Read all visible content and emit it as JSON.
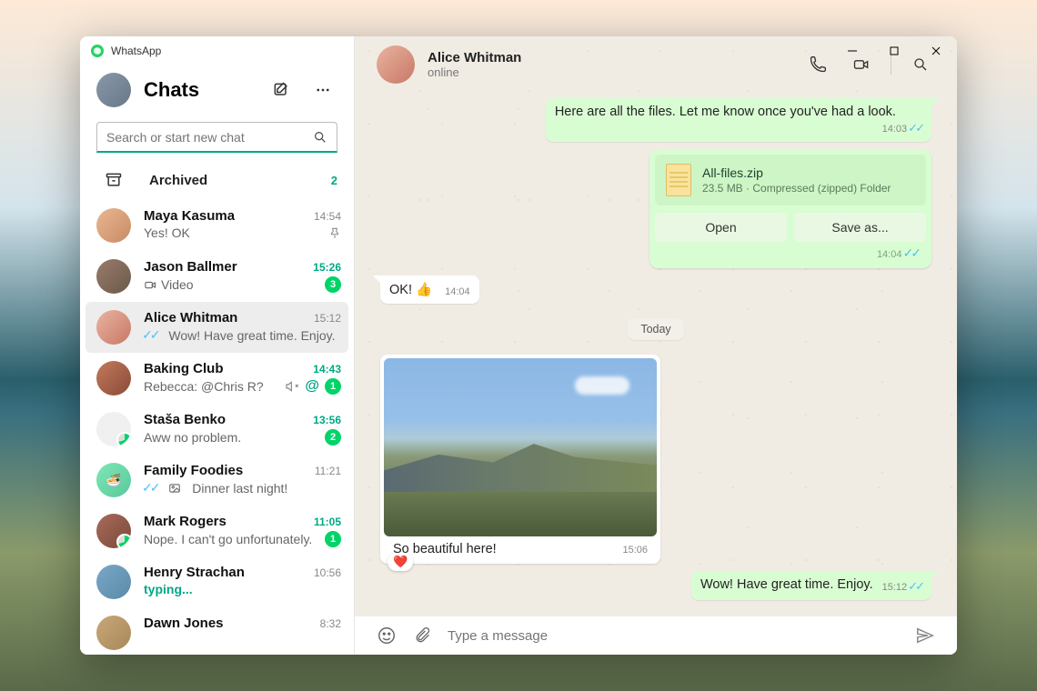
{
  "app": {
    "name": "WhatsApp"
  },
  "sidebar": {
    "title": "Chats",
    "search_placeholder": "Search or start new chat",
    "archived_label": "Archived",
    "archived_count": "2"
  },
  "chats": [
    {
      "name": "Maya Kasuma",
      "time": "14:54",
      "preview": "Yes! OK",
      "pinned": true
    },
    {
      "name": "Jason Ballmer",
      "time": "15:26",
      "preview": "Video",
      "video": true,
      "unread": "3"
    },
    {
      "name": "Alice Whitman",
      "time": "15:12",
      "preview": "Wow! Have great time. Enjoy.",
      "read_ticks": true,
      "active": true
    },
    {
      "name": "Baking Club",
      "time": "14:43",
      "preview": "Rebecca: @Chris R?",
      "muted": true,
      "mention": true,
      "unread": "1"
    },
    {
      "name": "Staša Benko",
      "time": "13:56",
      "preview": "Aww no problem.",
      "unread": "2"
    },
    {
      "name": "Family Foodies",
      "time": "11:21",
      "preview": "Dinner last night!",
      "read_ticks": true,
      "photo": true
    },
    {
      "name": "Mark Rogers",
      "time": "11:05",
      "preview": "Nope. I can't go unfortunately.",
      "unread": "1"
    },
    {
      "name": "Henry Strachan",
      "time": "10:56",
      "preview": "typing...",
      "typing": true
    },
    {
      "name": "Dawn Jones",
      "time": "8:32",
      "preview": ""
    }
  ],
  "conversation": {
    "name": "Alice Whitman",
    "status": "online",
    "messages": {
      "m1": {
        "text": "Here are all the files. Let me know once you've had a look.",
        "time": "14:03"
      },
      "file": {
        "name": "All-files.zip",
        "detail": "23.5 MB · Compressed (zipped) Folder",
        "open": "Open",
        "save": "Save as...",
        "time": "14:04"
      },
      "m2": {
        "text": "OK! 👍",
        "time": "14:04"
      },
      "date": "Today",
      "photo": {
        "caption": "So beautiful here!",
        "time": "15:06",
        "reaction": "❤️"
      },
      "m3": {
        "text": "Wow! Have great time. Enjoy.",
        "time": "15:12"
      }
    },
    "composer_placeholder": "Type a message"
  }
}
